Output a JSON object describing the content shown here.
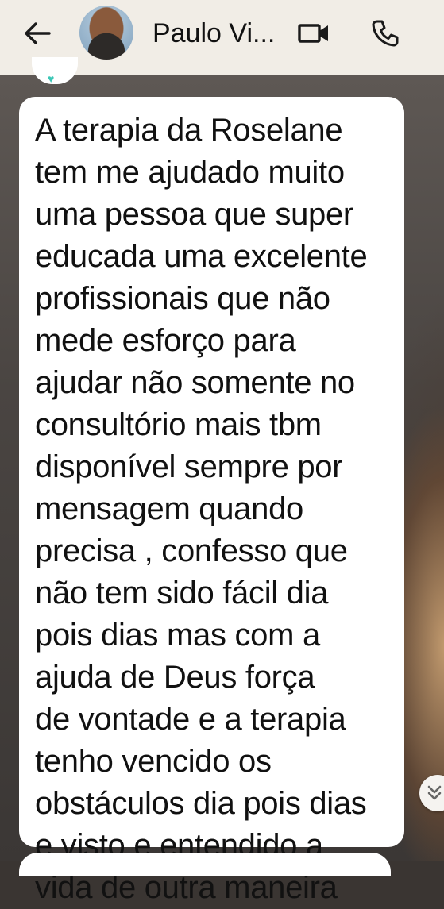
{
  "header": {
    "contact_name": "Paulo Vi...",
    "icons": {
      "back": "arrow-left-icon",
      "video": "video-camera-icon",
      "call": "phone-icon"
    }
  },
  "message": {
    "lines": [
      "A terapia da Roselane",
      "tem me ajudado muito",
      "uma pessoa que super",
      "educada uma excelente",
      "profissionais que não",
      "mede esforço para",
      "ajudar não somente no",
      "consultório mais tbm",
      "disponível sempre por",
      "mensagem quando",
      "precisa , confesso que",
      "não tem sido fácil dia",
      "pois dias mas com a",
      "ajuda de Deus força",
      "de vontade e a terapia",
      "tenho vencido os",
      "obstáculos dia pois dias",
      "e visto e entendido a",
      "vida de outra maneira"
    ]
  },
  "scroll_button": {
    "icon": "chevron-double-down-icon"
  },
  "colors": {
    "header_bg": "#f1ede6",
    "bubble_bg": "#ffffff",
    "text": "#111111"
  }
}
